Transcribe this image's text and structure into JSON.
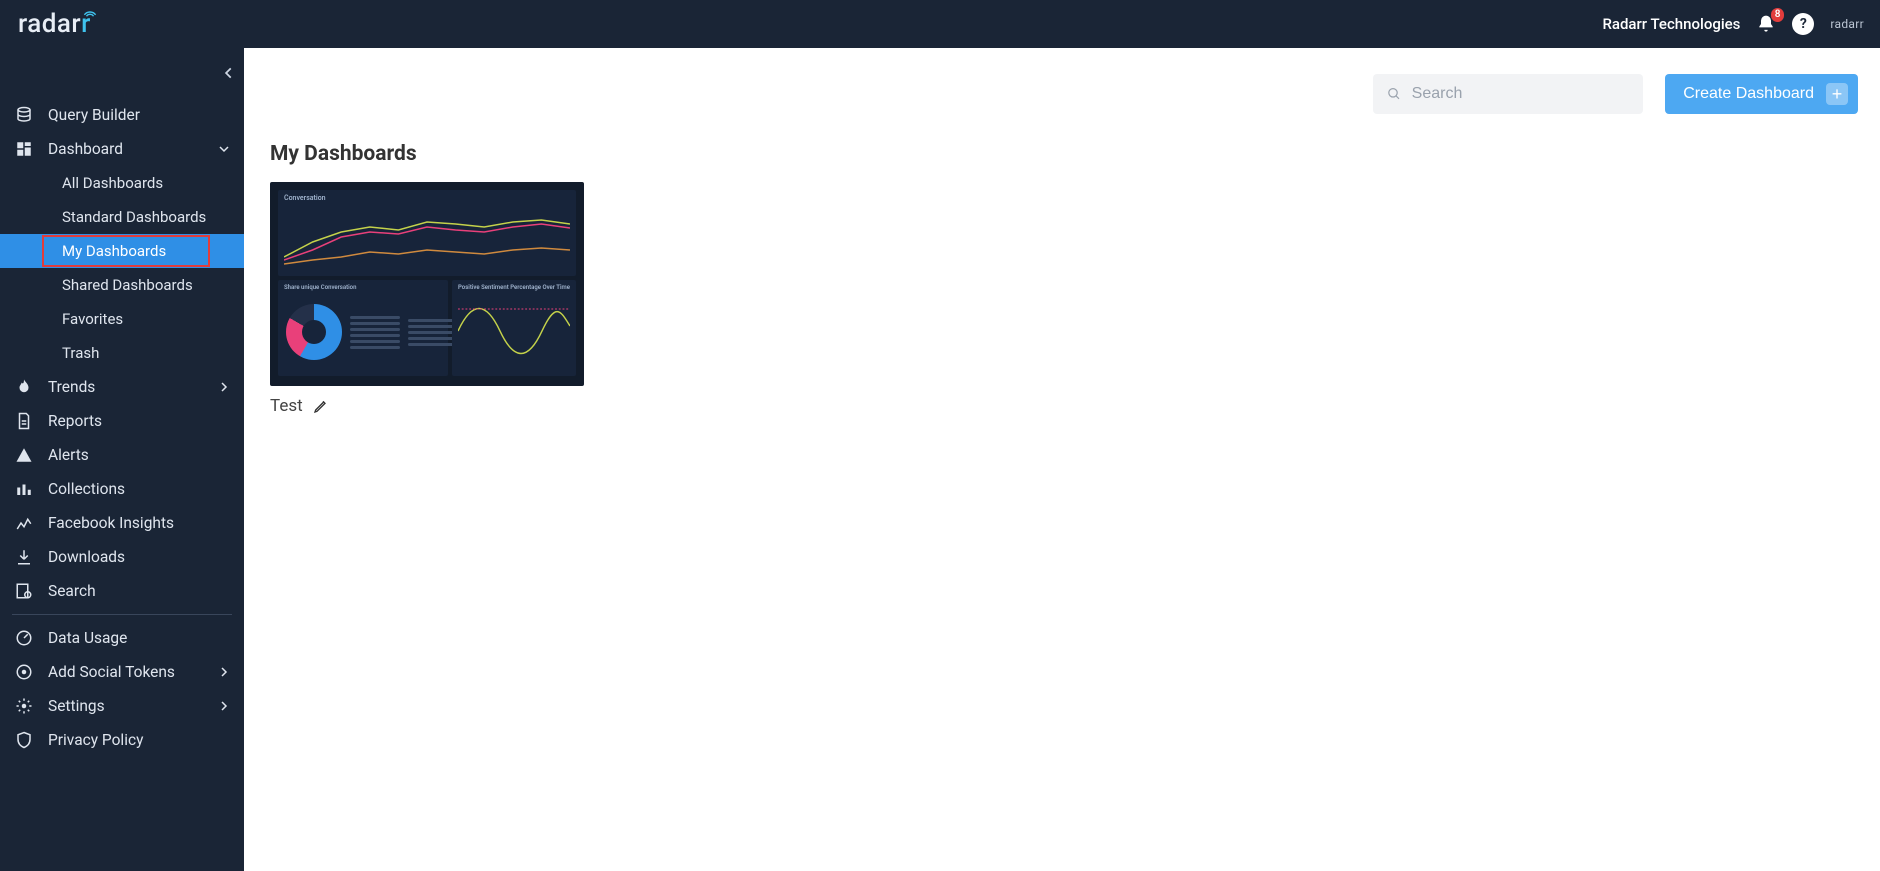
{
  "header": {
    "brand": "radarr",
    "org": "Radarr Technologies",
    "notification_count": "8",
    "mini_brand": "radarr"
  },
  "sidebar": {
    "items": [
      {
        "key": "query-builder",
        "label": "Query Builder",
        "expandable": false
      },
      {
        "key": "dashboard",
        "label": "Dashboard",
        "expandable": true,
        "expanded": true,
        "children": [
          {
            "key": "all",
            "label": "All Dashboards"
          },
          {
            "key": "standard",
            "label": "Standard Dashboards"
          },
          {
            "key": "my",
            "label": "My Dashboards",
            "active": true,
            "highlight": true
          },
          {
            "key": "shared",
            "label": "Shared Dashboards"
          },
          {
            "key": "favorites",
            "label": "Favorites"
          },
          {
            "key": "trash",
            "label": "Trash"
          }
        ]
      },
      {
        "key": "trends",
        "label": "Trends",
        "expandable": true
      },
      {
        "key": "reports",
        "label": "Reports"
      },
      {
        "key": "alerts",
        "label": "Alerts"
      },
      {
        "key": "collections",
        "label": "Collections"
      },
      {
        "key": "fb-insights",
        "label": "Facebook Insights"
      },
      {
        "key": "downloads",
        "label": "Downloads"
      },
      {
        "key": "search",
        "label": "Search"
      },
      {
        "key": "data-usage",
        "label": "Data Usage",
        "group": "secondary"
      },
      {
        "key": "add-social",
        "label": "Add Social Tokens",
        "expandable": true,
        "group": "secondary"
      },
      {
        "key": "settings",
        "label": "Settings",
        "expandable": true,
        "group": "secondary"
      },
      {
        "key": "privacy",
        "label": "Privacy Policy",
        "group": "secondary"
      }
    ]
  },
  "toolbar": {
    "search_placeholder": "Search",
    "create_label": "Create Dashboard"
  },
  "page": {
    "title": "My Dashboards"
  },
  "dashboards": [
    {
      "name": "Test",
      "preview": {
        "top_title": "Conversation",
        "bottom_left_title": "Share unique Conversation",
        "bottom_right_title": "Positive Sentiment Percentage Over Time"
      }
    }
  ]
}
